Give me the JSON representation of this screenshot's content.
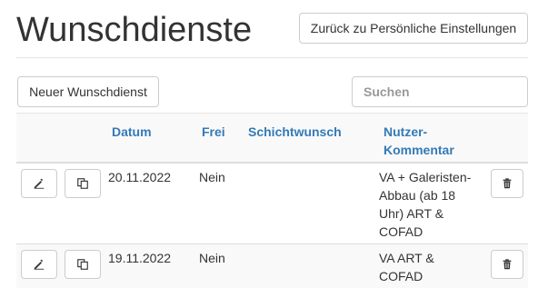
{
  "page": {
    "title": "Wunschdienste",
    "back_button": "Zurück zu Persönliche Einstellungen"
  },
  "toolbar": {
    "new_button": "Neuer Wunschdienst",
    "search_placeholder": "Suchen"
  },
  "table": {
    "headers": {
      "date": "Datum",
      "free": "Frei",
      "shift": "Schichtwunsch",
      "comment_line1": "Nutzer-",
      "comment_line2": "Kommentar"
    },
    "rows": [
      {
        "date": "20.11.2022",
        "free": "Nein",
        "shift": "",
        "comment_lines": [
          "VA + Galeristen-",
          "Abbau (ab 18",
          "Uhr) ART &",
          "COFAD"
        ]
      },
      {
        "date": "19.11.2022",
        "free": "Nein",
        "shift": "",
        "comment_lines": [
          "VA ART &",
          "COFAD"
        ]
      }
    ]
  },
  "icons": {
    "edit": "edit-icon",
    "copy": "copy-icon",
    "delete": "trash-icon"
  }
}
